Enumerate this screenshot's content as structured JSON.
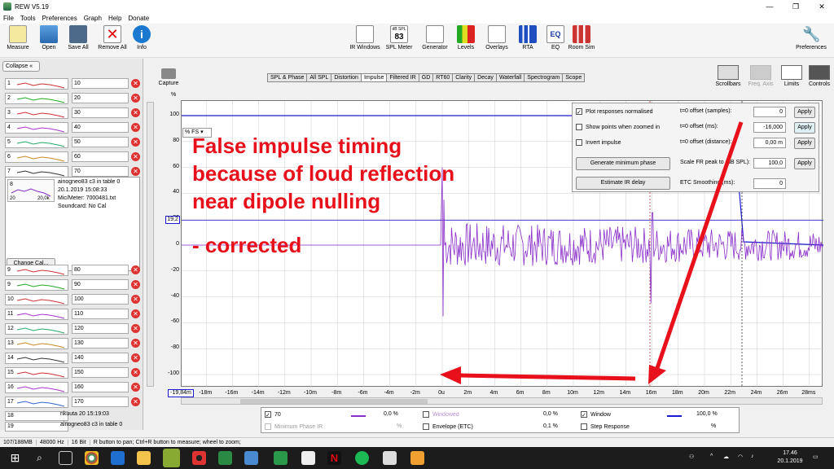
{
  "window": {
    "title": "REW V5.19",
    "min": "—",
    "max": "❐",
    "close": "✕"
  },
  "menu": [
    "File",
    "Tools",
    "Preferences",
    "Graph",
    "Help",
    "Donate"
  ],
  "toolbar": {
    "left": [
      "Measure",
      "Open",
      "Save All",
      "Remove All",
      "Info"
    ],
    "center": [
      "IR Windows",
      "SPL Meter",
      "Generator",
      "Levels",
      "Overlays",
      "RTA",
      "EQ",
      "Room Sim"
    ],
    "spl_badge_top": "dB SPL",
    "spl_badge_value": "83",
    "eq_badge": "EQ",
    "right": "Preferences"
  },
  "sidebar": {
    "collapse_label": "Collapse",
    "capture_label": "Capture",
    "top_rows": [
      {
        "num": "1",
        "name": "10"
      },
      {
        "num": "2",
        "name": "20"
      },
      {
        "num": "3",
        "name": "30"
      },
      {
        "num": "4",
        "name": "40"
      },
      {
        "num": "5",
        "name": "50"
      },
      {
        "num": "6",
        "name": "60"
      },
      {
        "num": "7",
        "name": "70"
      }
    ],
    "selected": {
      "num": "8",
      "desc1": "ainogneo83 c3 in table 0",
      "desc2": "20.1.2019 15:08:33",
      "desc3": "Mic/Meter: 7000481.txt",
      "desc4": "Soundcard: No Cal",
      "f_lo": "20",
      "f_hi": "20,0k"
    },
    "change_cal": "Change Cal...",
    "bottom_rows": [
      {
        "num": "9",
        "name": "80"
      },
      {
        "num": "9",
        "name": "90"
      },
      {
        "num": "10",
        "name": "100"
      },
      {
        "num": "11",
        "name": "110"
      },
      {
        "num": "12",
        "name": "120"
      },
      {
        "num": "13",
        "name": "130"
      },
      {
        "num": "14",
        "name": "140"
      },
      {
        "num": "15",
        "name": "150"
      },
      {
        "num": "16",
        "name": "160"
      },
      {
        "num": "17",
        "name": "170"
      }
    ],
    "row18": {
      "num": "18",
      "name": "nkuuta 20 15:19:03"
    },
    "row19": {
      "num": "19",
      "name": "ainogneo83 c3 in table 0"
    }
  },
  "tabs": [
    "SPL & Phase",
    "All SPL",
    "Distortion",
    "Impulse",
    "Filtered IR",
    "GD",
    "RT60",
    "Clarity",
    "Decay",
    "Waterfall",
    "Spectrogram",
    "Scope"
  ],
  "active_tab": "Impulse",
  "right_tools": [
    "Scrollbars",
    "Freq. Axis",
    "Limits",
    "Controls"
  ],
  "graph": {
    "unit": "%",
    "scale_dropdown": "% FS",
    "marker_value": "19,2",
    "cursor_x": "-19,84m",
    "yticks": [
      "100",
      "80",
      "60",
      "40",
      "20",
      "0",
      "-20",
      "-40",
      "-60",
      "-80",
      "-100"
    ],
    "xticks": [
      "-18m",
      "-16m",
      "-14m",
      "-12m",
      "-10m",
      "-8m",
      "-6m",
      "-4m",
      "-2m",
      "0u",
      "2m",
      "4m",
      "6m",
      "8m",
      "10m",
      "12m",
      "14m",
      "16m",
      "18m",
      "20m",
      "22m",
      "24m",
      "26m",
      "28ms"
    ]
  },
  "controls": {
    "plot_normalised": "Plot responses normalised",
    "show_points": "Show points when zoomed in",
    "invert": "Invert impulse",
    "gen_min_phase": "Generate minimum phase",
    "estimate_ir": "Estimate IR delay",
    "t0_samples_label": "t=0 offset (samples):",
    "t0_samples_val": "0",
    "t0_ms_label": "t=0 offset (ms):",
    "t0_ms_val": "-16,000",
    "t0_dist_label": "t=0 offset (distance):",
    "t0_dist_val": "0,00 m",
    "scale_label": "Scale FR peak to (dB SPL):",
    "scale_val": "100,0",
    "etc_label": "ETC Smoothing (ms):",
    "etc_val": "0",
    "apply": "Apply"
  },
  "annotation": {
    "line1": "False impulse timing",
    "line2": "because of loud reflection",
    "line3": "near dipole nulling",
    "line4": "- corrected"
  },
  "legend": {
    "c1_name": "70",
    "c1_val": "0,0 %",
    "c2_name": "Windowed",
    "c2_val": "0,0 %",
    "c3_name": "Window",
    "c3_val": "100,0 %",
    "c4_name": "Minimum Phase IR",
    "c4_val": "%",
    "c5_name": "Envelope (ETC)",
    "c5_val": "0,1 %",
    "c6_name": "Step Response",
    "c6_val": "%"
  },
  "status": {
    "mem": "107/188MB",
    "rate": "48000 Hz",
    "bits": "16 Bit",
    "hint": "R button to pan; Ctrl+R button to measure; wheel to zoom;"
  },
  "tray": {
    "time": "17.46",
    "date": "20.1.2019"
  },
  "colors": {
    "trace": "#8a2fc9",
    "window": "#1a1ad0",
    "annotation": "#e8101a",
    "arrow": "#e8101a"
  }
}
